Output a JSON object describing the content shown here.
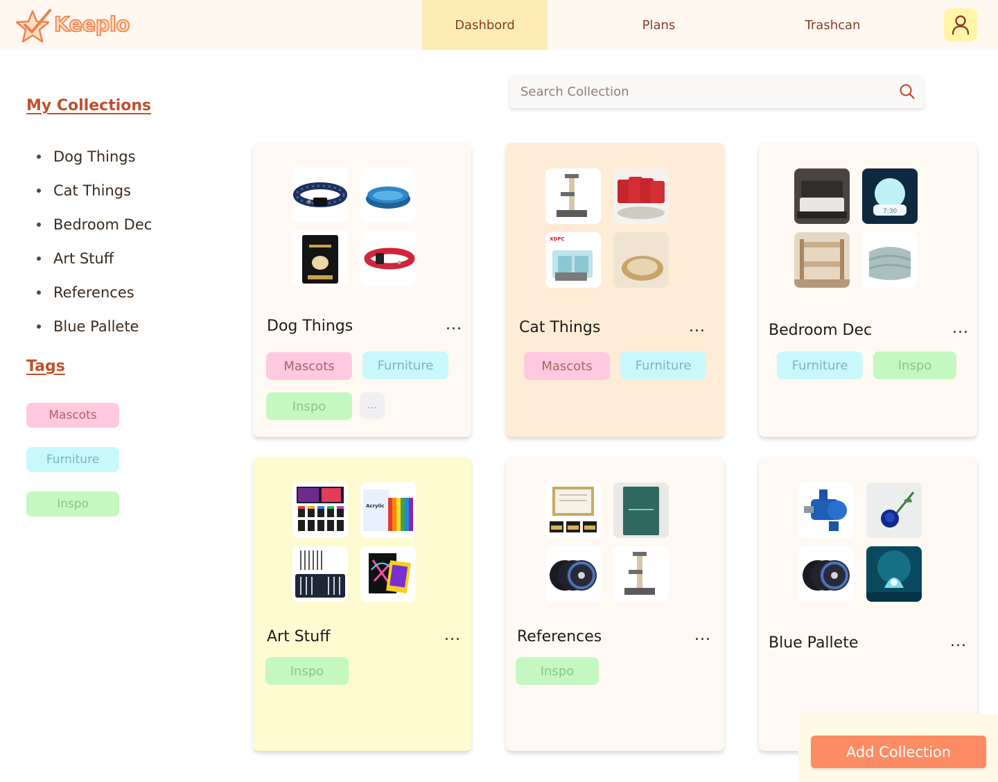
{
  "app": {
    "logo_text": "Keeplo"
  },
  "nav": {
    "items": [
      "Dashbord",
      "Plans",
      "Trashcan"
    ],
    "active": "Dashbord"
  },
  "sidebar": {
    "collections_heading": "My Collections",
    "collections": [
      "Dog Things",
      "Cat Things",
      "Bedroom Dec",
      "Art Stuff",
      "References",
      "Blue Pallete"
    ],
    "tags_heading": "Tags",
    "tags": [
      "Mascots",
      "Furniture",
      "Inspo"
    ]
  },
  "search": {
    "placeholder": "Search Collection"
  },
  "cards": [
    {
      "title": "Dog Things",
      "more": "...",
      "tags": [
        "Mascots",
        "Furniture",
        "Inspo",
        "..."
      ]
    },
    {
      "title": "Cat Things",
      "more": "...",
      "tags": [
        "Mascots",
        "Furniture"
      ]
    },
    {
      "title": "Bedroom Dec",
      "more": "...",
      "tags": [
        "Furniture",
        "Inspo"
      ]
    },
    {
      "title": "Art Stuff",
      "more": "...",
      "tags": [
        "Inspo"
      ]
    },
    {
      "title": "References",
      "more": "...",
      "tags": [
        "Inspo"
      ]
    },
    {
      "title": "Blue Pallete",
      "more": "...",
      "tags": []
    }
  ],
  "actions": {
    "add_collection": "Add Collection"
  },
  "colors": {
    "accent": "#fd8b63",
    "nav_active": "#fdedb5",
    "heading": "#c0502a",
    "tag_mascots": "#ffc9df",
    "tag_furniture": "#c8f8fc",
    "tag_inspo": "#c5f7c0"
  }
}
